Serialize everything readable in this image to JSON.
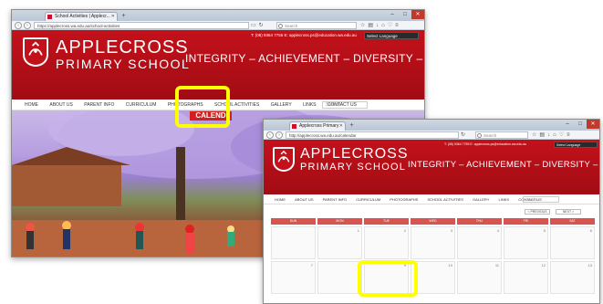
{
  "window1": {
    "tab_title": "School Activities | Applecr...",
    "address": "https://applecross.wa.edu.au/school-activities",
    "search_placeholder": "Search",
    "controls": [
      "–",
      "□",
      "✕"
    ]
  },
  "window2": {
    "tab_title": "Applecross Primary",
    "address": "http://applecross.wa.edu.au/calendar",
    "search_placeholder": "Search",
    "controls": [
      "–",
      "□",
      "✕"
    ]
  },
  "site": {
    "school_line1": "APPLECROSS",
    "school_line2": "PRIMARY SCHOOL",
    "motto": "INTEGRITY – ACHIEVEMENT – DIVERSITY – GROWTH",
    "contact": "T: (08) 9364 7755   E: applecross.ps@education.wa.edu.au",
    "language_select": "Select Language",
    "menu": [
      "HOME",
      "ABOUT US",
      "PARENT INFO",
      "CURRICULUM",
      "PHOTOGRAPHS",
      "SCHOOL ACTIVITIES",
      "GALLERY",
      "LINKS",
      "CONTACT US"
    ],
    "menu_search": "Search",
    "dropdown_item": "CALEND"
  },
  "calendar": {
    "prev_label": "< PREVIOUS",
    "next_label": "NEXT >",
    "day_headers": [
      "SUN",
      "MON",
      "TUE",
      "WED",
      "THU",
      "FRI",
      "SAT"
    ],
    "day_numbers": [
      "",
      "1",
      "2",
      "3",
      "4",
      "5",
      "6",
      "7",
      "8",
      "9",
      "10",
      "11",
      "12",
      "13"
    ]
  },
  "colors": {
    "brand_red": "#c3111b",
    "highlight": "#ffff00"
  },
  "icons": [
    "back-icon",
    "forward-icon",
    "refresh-icon",
    "home-icon",
    "download-icon",
    "bookmark-icon",
    "menu-icon",
    "search-icon",
    "crest-logo"
  ]
}
